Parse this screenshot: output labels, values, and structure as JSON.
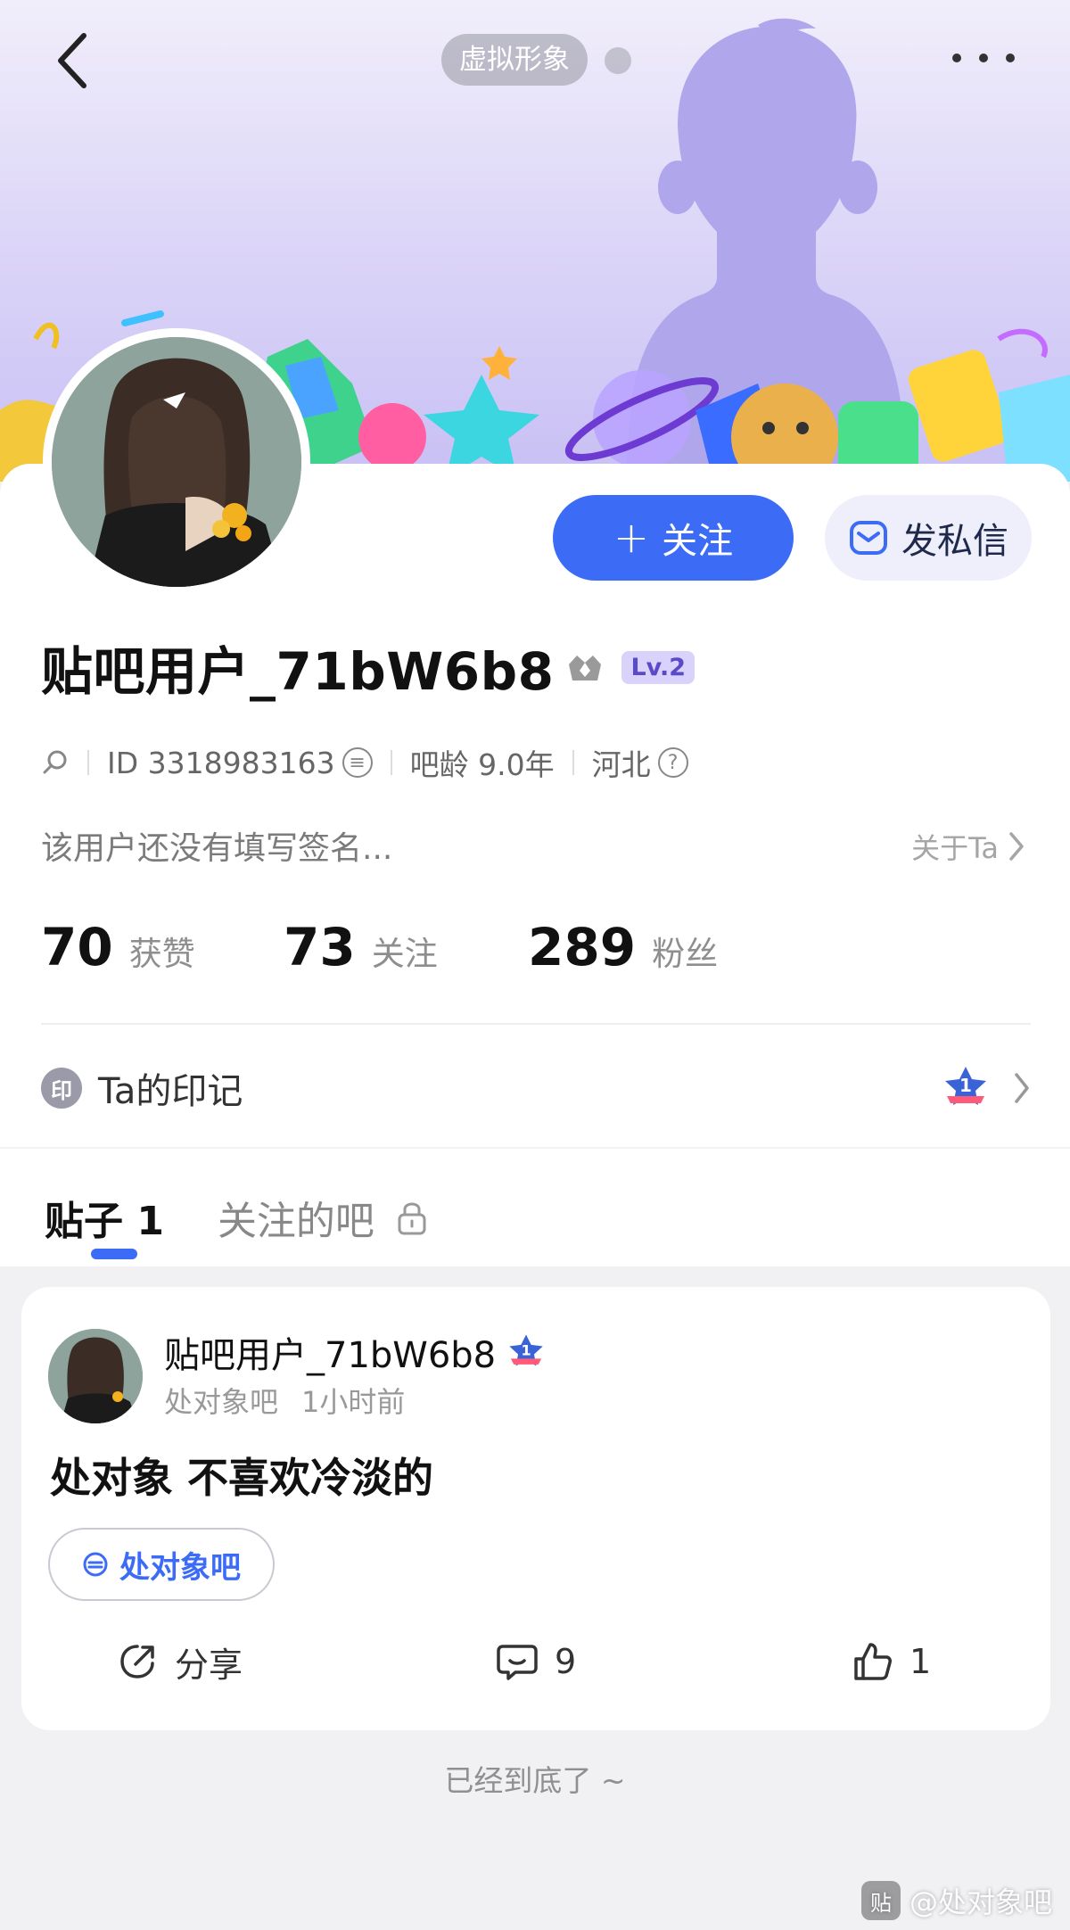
{
  "header": {
    "avatar_tag": "虚拟形象"
  },
  "profile": {
    "follow_label": "关注",
    "message_label": "发私信",
    "username": "贴吧用户_71bW6b8",
    "level": "Lv.2",
    "id_text": "ID 3318983163",
    "age_text": "吧龄 9.0年",
    "location": "河北",
    "signature": "该用户还没有填写签名...",
    "about_label": "关于Ta",
    "stats": [
      {
        "num": "70",
        "label": "获赞"
      },
      {
        "num": "73",
        "label": "关注"
      },
      {
        "num": "289",
        "label": "粉丝"
      }
    ],
    "marks_icon_text": "印",
    "marks_label": "Ta的印记",
    "marks_badge_number": "1"
  },
  "tabs": [
    {
      "label": "贴子 1"
    },
    {
      "label": "关注的吧"
    }
  ],
  "post": {
    "author": "贴吧用户_71bW6b8",
    "forum_name": "处对象吧",
    "time": "1小时前",
    "title": "处对象 不喜欢冷淡的",
    "chip_label": "处对象吧",
    "share_label": "分享",
    "comment_count": "9",
    "like_count": "1"
  },
  "footer": {
    "end_text": "已经到底了 ~",
    "watermark_text": "@处对象吧",
    "watermark_icon_text": "贴"
  },
  "colors": {
    "accent": "#3c6cf6",
    "level_bg": "#d9d2fb"
  }
}
